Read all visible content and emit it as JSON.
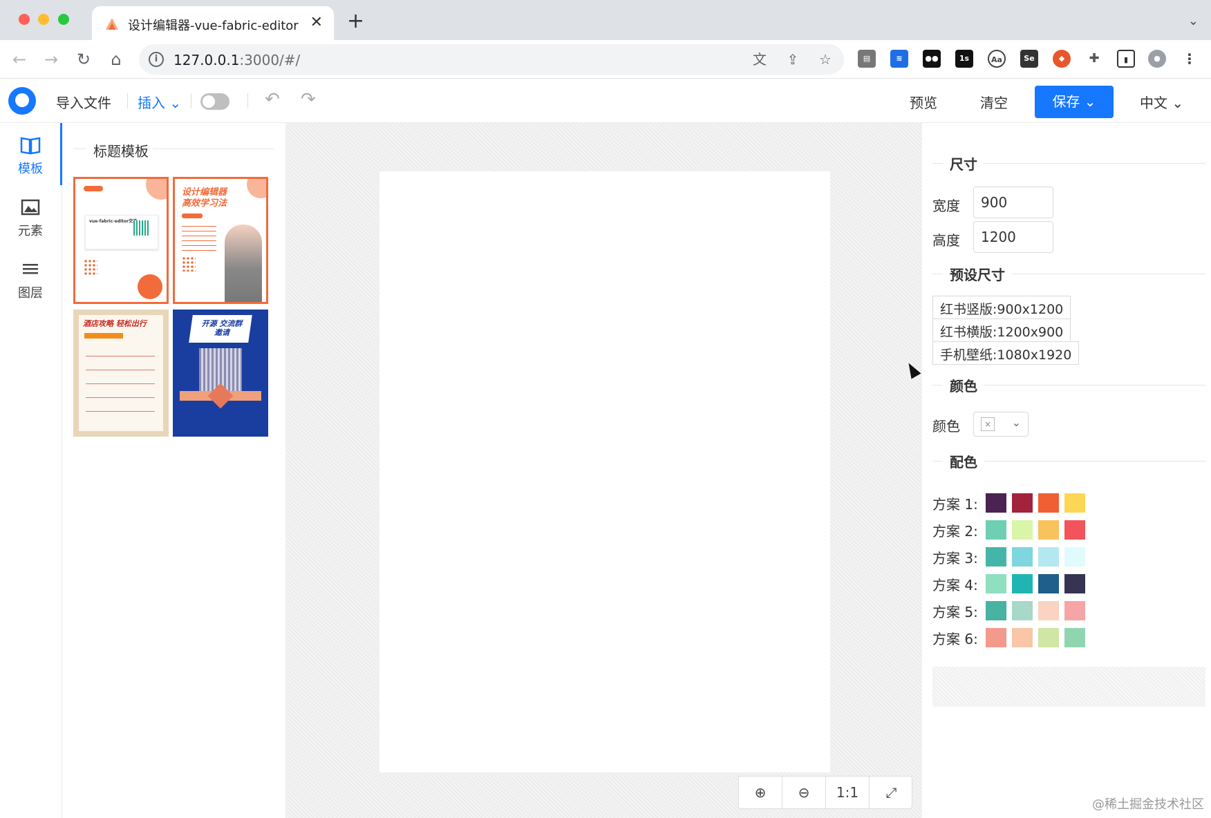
{
  "browser": {
    "tab_title": "设计编辑器-vue-fabric-editor",
    "url_host": "127.0.0.1",
    "url_rest": ":3000/#/",
    "colors": {
      "close": "#ff5f57",
      "minimize": "#febc2e",
      "maximize": "#28c840"
    }
  },
  "app": {
    "import_label": "导入文件",
    "insert_label": "插入",
    "preview_label": "预览",
    "clear_label": "清空",
    "save_label": "保存",
    "language_label": "中文",
    "accent_color": "#1677ff"
  },
  "rail": {
    "items": [
      {
        "label": "模板",
        "icon": "book-icon",
        "active": true
      },
      {
        "label": "元素",
        "icon": "image-icon",
        "active": false
      },
      {
        "label": "图层",
        "icon": "layers-icon",
        "active": false
      }
    ]
  },
  "panel": {
    "title": "标题模板",
    "templates": [
      {
        "text": "vue-fabric-editor交流"
      },
      {
        "text": "设计编辑器 高效学习法"
      },
      {
        "text": "酒店攻略 轻松出行"
      },
      {
        "text": "开源 交流群邀请"
      }
    ]
  },
  "zoom": {
    "fit_label": "1:1"
  },
  "props": {
    "size_title": "尺寸",
    "width_label": "宽度",
    "width_value": "900",
    "height_label": "高度",
    "height_value": "1200",
    "preset_title": "预设尺寸",
    "presets": [
      "红书竖版:900x1200",
      "红书横版:1200x900",
      "手机壁纸:1080x1920"
    ],
    "color_title": "颜色",
    "color_label": "颜色",
    "palette_title": "配色",
    "schemes": [
      {
        "label": "方案 1:",
        "colors": [
          "#4a2352",
          "#a3223d",
          "#f05f33",
          "#fdd754"
        ]
      },
      {
        "label": "方案 2:",
        "colors": [
          "#6fcfb3",
          "#d9f5a8",
          "#f8c25d",
          "#f2545b"
        ]
      },
      {
        "label": "方案 3:",
        "colors": [
          "#46b5a9",
          "#7ed6df",
          "#b3e8f0",
          "#e0fbfc"
        ]
      },
      {
        "label": "方案 4:",
        "colors": [
          "#8fdfc1",
          "#1fb5b3",
          "#1f5f8b",
          "#373353"
        ]
      },
      {
        "label": "方案 5:",
        "colors": [
          "#48b2a3",
          "#a8d8c8",
          "#fbd3c3",
          "#f6a5a7"
        ]
      },
      {
        "label": "方案 6:",
        "colors": [
          "#f49a8c",
          "#f9c6a8",
          "#cfe6a5",
          "#8fd6b0"
        ]
      }
    ]
  },
  "watermark": "@稀土掘金技术社区"
}
